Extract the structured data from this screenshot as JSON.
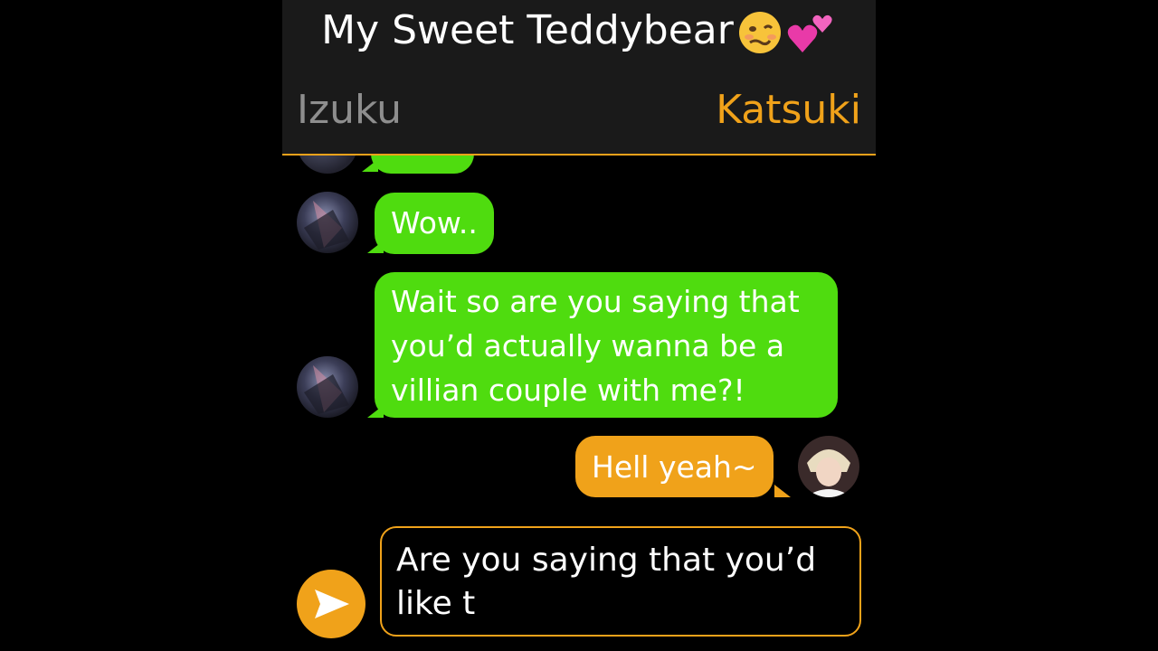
{
  "header": {
    "title": "My Sweet Teddybear",
    "title_emojis": [
      "woozy-face-icon",
      "two-hearts-icon"
    ],
    "left_name": "Izuku",
    "right_name": "Katsuki"
  },
  "messages": [
    {
      "sender": "Izuku",
      "text": "Wow.."
    },
    {
      "sender": "Izuku",
      "text": "Wait so are you saying that you’d actually wanna be a villian couple with me?!"
    },
    {
      "sender": "Katsuki",
      "text": "Hell yeah~"
    }
  ],
  "composer": {
    "text": "Are you saying that you’d like t",
    "send_icon": "send-arrow-icon"
  },
  "colors": {
    "accent": "#f0a21a",
    "izuku_bubble": "#4fdc0f",
    "katsuki_bubble": "#f0a21a",
    "header_bg": "#1a1a1a",
    "background": "#000000"
  }
}
